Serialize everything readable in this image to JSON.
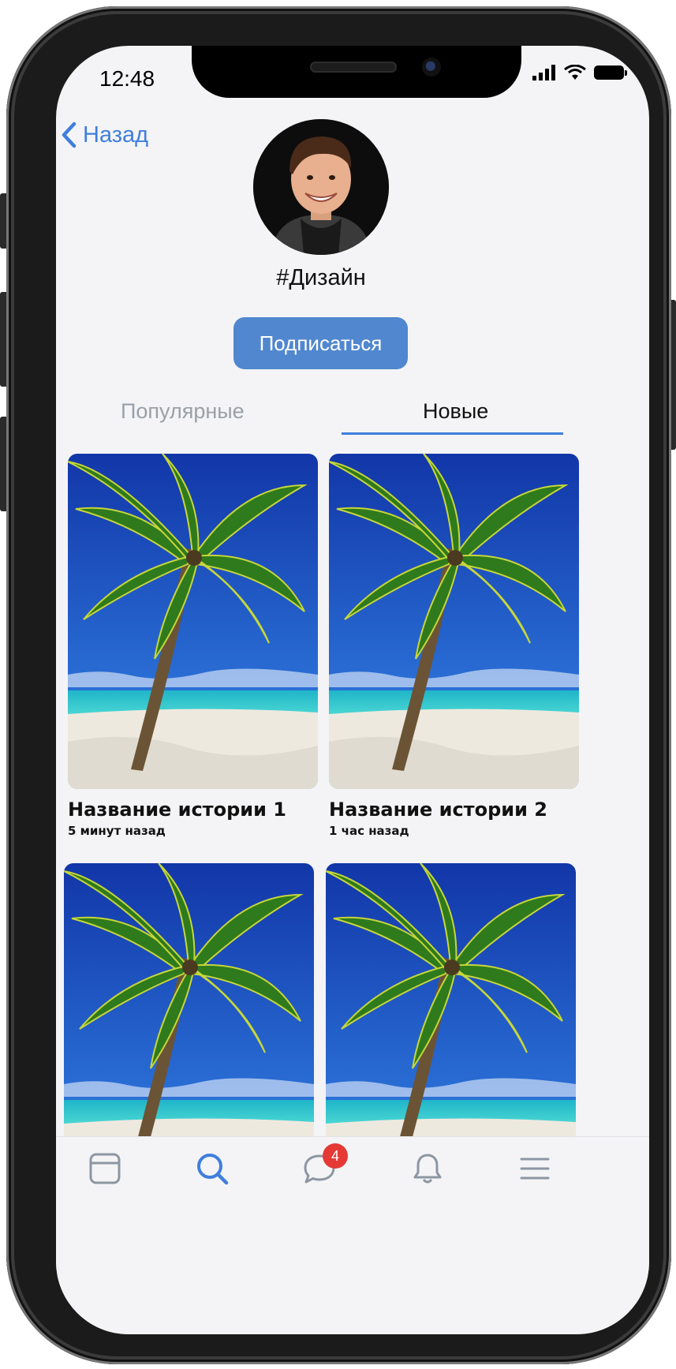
{
  "status_bar": {
    "time": "12:48"
  },
  "header": {
    "back_label": "Назад",
    "channel_title": "#Дизайн",
    "subscribe_label": "Подписаться"
  },
  "tabs": [
    {
      "label": "Популярные",
      "active": false
    },
    {
      "label": "Новые",
      "active": true
    }
  ],
  "stories": [
    {
      "title": "Название истории 1",
      "time": "5 минут назад"
    },
    {
      "title": "Название истории 2",
      "time": "1 час назад"
    },
    {
      "title": "",
      "time": ""
    },
    {
      "title": "",
      "time": ""
    }
  ],
  "tabbar": {
    "items": [
      "feed-icon",
      "search-icon",
      "messages-icon",
      "bell-icon",
      "menu-icon"
    ],
    "messages_badge": "4",
    "active_item": "search-icon"
  },
  "colors": {
    "accent": "#3f7fdc",
    "button": "#5087cf",
    "badge": "#e53935",
    "background": "#f4f4f6"
  }
}
